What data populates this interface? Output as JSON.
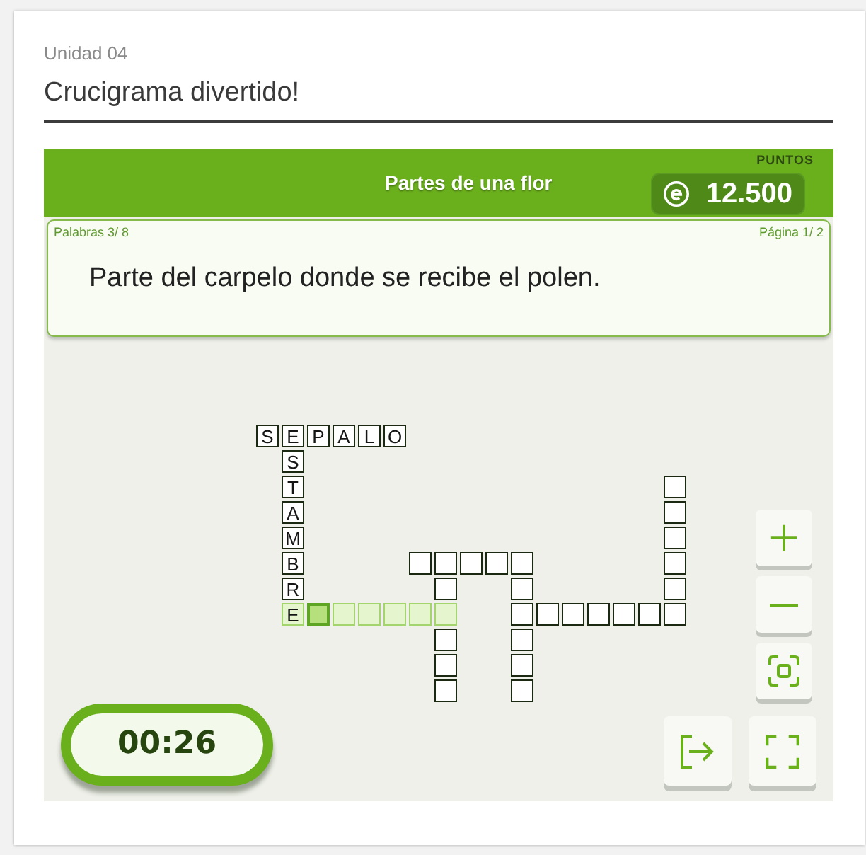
{
  "unit": "Unidad 04",
  "title": "Crucigrama divertido!",
  "game": {
    "topic": "Partes de una flor",
    "points": {
      "label": "PUNTOS",
      "value": "12.500"
    },
    "clue": {
      "words": "Palabras 3/ 8",
      "page": "Página 1/ 2",
      "text": "Parte del carpelo donde se recibe el polen."
    },
    "grid": {
      "rows": [
        {
          "cells": [
            {
              "kind": "square",
              "letter": "S",
              "highlighted": false,
              "selected": false
            },
            {
              "kind": "square",
              "letter": "E",
              "highlighted": false,
              "selected": false
            },
            {
              "kind": "square",
              "letter": "P",
              "highlighted": false,
              "selected": false
            },
            {
              "kind": "square",
              "letter": "A",
              "highlighted": false,
              "selected": false
            },
            {
              "kind": "square",
              "letter": "L",
              "highlighted": false,
              "selected": false
            },
            {
              "kind": "square",
              "letter": "O",
              "highlighted": false,
              "selected": false
            },
            {
              "kind": "gap"
            },
            {
              "kind": "gap"
            },
            {
              "kind": "gap"
            },
            {
              "kind": "gap"
            },
            {
              "kind": "gap"
            },
            {
              "kind": "gap"
            },
            {
              "kind": "gap"
            },
            {
              "kind": "gap"
            },
            {
              "kind": "gap"
            },
            {
              "kind": "gap"
            },
            {
              "kind": "gap"
            }
          ]
        },
        {
          "cells": [
            {
              "kind": "gap"
            },
            {
              "kind": "square",
              "letter": "S",
              "highlighted": false,
              "selected": false
            },
            {
              "kind": "gap"
            },
            {
              "kind": "gap"
            },
            {
              "kind": "gap"
            },
            {
              "kind": "gap"
            },
            {
              "kind": "gap"
            },
            {
              "kind": "gap"
            },
            {
              "kind": "gap"
            },
            {
              "kind": "gap"
            },
            {
              "kind": "gap"
            },
            {
              "kind": "gap"
            },
            {
              "kind": "gap"
            },
            {
              "kind": "gap"
            },
            {
              "kind": "gap"
            },
            {
              "kind": "gap"
            },
            {
              "kind": "gap"
            }
          ]
        },
        {
          "cells": [
            {
              "kind": "gap"
            },
            {
              "kind": "square",
              "letter": "T",
              "highlighted": false,
              "selected": false
            },
            {
              "kind": "gap"
            },
            {
              "kind": "gap"
            },
            {
              "kind": "gap"
            },
            {
              "kind": "gap"
            },
            {
              "kind": "gap"
            },
            {
              "kind": "gap"
            },
            {
              "kind": "gap"
            },
            {
              "kind": "gap"
            },
            {
              "kind": "gap"
            },
            {
              "kind": "gap"
            },
            {
              "kind": "gap"
            },
            {
              "kind": "gap"
            },
            {
              "kind": "gap"
            },
            {
              "kind": "gap"
            },
            {
              "kind": "square",
              "highlighted": false,
              "selected": false
            }
          ]
        },
        {
          "cells": [
            {
              "kind": "gap"
            },
            {
              "kind": "square",
              "letter": "A",
              "highlighted": false,
              "selected": false
            },
            {
              "kind": "gap"
            },
            {
              "kind": "gap"
            },
            {
              "kind": "gap"
            },
            {
              "kind": "gap"
            },
            {
              "kind": "gap"
            },
            {
              "kind": "gap"
            },
            {
              "kind": "gap"
            },
            {
              "kind": "gap"
            },
            {
              "kind": "gap"
            },
            {
              "kind": "gap"
            },
            {
              "kind": "gap"
            },
            {
              "kind": "gap"
            },
            {
              "kind": "gap"
            },
            {
              "kind": "gap"
            },
            {
              "kind": "square",
              "highlighted": false,
              "selected": false
            }
          ]
        },
        {
          "cells": [
            {
              "kind": "gap"
            },
            {
              "kind": "square",
              "letter": "M",
              "highlighted": false,
              "selected": false
            },
            {
              "kind": "gap"
            },
            {
              "kind": "gap"
            },
            {
              "kind": "gap"
            },
            {
              "kind": "gap"
            },
            {
              "kind": "gap"
            },
            {
              "kind": "gap"
            },
            {
              "kind": "gap"
            },
            {
              "kind": "gap"
            },
            {
              "kind": "gap"
            },
            {
              "kind": "gap"
            },
            {
              "kind": "gap"
            },
            {
              "kind": "gap"
            },
            {
              "kind": "gap"
            },
            {
              "kind": "gap"
            },
            {
              "kind": "square",
              "highlighted": false,
              "selected": false
            }
          ]
        },
        {
          "cells": [
            {
              "kind": "gap"
            },
            {
              "kind": "square",
              "letter": "B",
              "highlighted": false,
              "selected": false
            },
            {
              "kind": "gap"
            },
            {
              "kind": "gap"
            },
            {
              "kind": "gap"
            },
            {
              "kind": "gap"
            },
            {
              "kind": "square",
              "highlighted": false,
              "selected": false
            },
            {
              "kind": "square",
              "highlighted": false,
              "selected": false
            },
            {
              "kind": "square",
              "highlighted": false,
              "selected": false
            },
            {
              "kind": "square",
              "highlighted": false,
              "selected": false
            },
            {
              "kind": "square",
              "highlighted": false,
              "selected": false
            },
            {
              "kind": "gap"
            },
            {
              "kind": "gap"
            },
            {
              "kind": "gap"
            },
            {
              "kind": "gap"
            },
            {
              "kind": "gap"
            },
            {
              "kind": "square",
              "highlighted": false,
              "selected": false
            }
          ]
        },
        {
          "cells": [
            {
              "kind": "gap"
            },
            {
              "kind": "square",
              "letter": "R",
              "highlighted": false,
              "selected": false
            },
            {
              "kind": "gap"
            },
            {
              "kind": "gap"
            },
            {
              "kind": "gap"
            },
            {
              "kind": "gap"
            },
            {
              "kind": "gap"
            },
            {
              "kind": "square",
              "highlighted": false,
              "selected": false
            },
            {
              "kind": "gap"
            },
            {
              "kind": "gap"
            },
            {
              "kind": "square",
              "highlighted": false,
              "selected": false
            },
            {
              "kind": "gap"
            },
            {
              "kind": "gap"
            },
            {
              "kind": "gap"
            },
            {
              "kind": "gap"
            },
            {
              "kind": "gap"
            },
            {
              "kind": "square",
              "highlighted": false,
              "selected": false
            }
          ]
        },
        {
          "cells": [
            {
              "kind": "gap"
            },
            {
              "kind": "square",
              "letter": "E",
              "highlighted": true,
              "selected": false
            },
            {
              "kind": "square",
              "highlighted": true,
              "selected": true
            },
            {
              "kind": "square",
              "highlighted": true,
              "selected": false
            },
            {
              "kind": "square",
              "highlighted": true,
              "selected": false
            },
            {
              "kind": "square",
              "highlighted": true,
              "selected": false
            },
            {
              "kind": "square",
              "highlighted": true,
              "selected": false
            },
            {
              "kind": "square",
              "highlighted": true,
              "selected": false
            },
            {
              "kind": "gap"
            },
            {
              "kind": "gap"
            },
            {
              "kind": "square",
              "highlighted": false,
              "selected": false
            },
            {
              "kind": "square",
              "highlighted": false,
              "selected": false
            },
            {
              "kind": "square",
              "highlighted": false,
              "selected": false
            },
            {
              "kind": "square",
              "highlighted": false,
              "selected": false
            },
            {
              "kind": "square",
              "highlighted": false,
              "selected": false
            },
            {
              "kind": "square",
              "highlighted": false,
              "selected": false
            },
            {
              "kind": "square",
              "highlighted": false,
              "selected": false
            }
          ]
        },
        {
          "cells": [
            {
              "kind": "gap"
            },
            {
              "kind": "gap"
            },
            {
              "kind": "gap"
            },
            {
              "kind": "gap"
            },
            {
              "kind": "gap"
            },
            {
              "kind": "gap"
            },
            {
              "kind": "gap"
            },
            {
              "kind": "square",
              "highlighted": false,
              "selected": false
            },
            {
              "kind": "gap"
            },
            {
              "kind": "gap"
            },
            {
              "kind": "square",
              "highlighted": false,
              "selected": false
            },
            {
              "kind": "gap"
            },
            {
              "kind": "gap"
            },
            {
              "kind": "gap"
            },
            {
              "kind": "gap"
            },
            {
              "kind": "gap"
            },
            {
              "kind": "gap"
            }
          ]
        },
        {
          "cells": [
            {
              "kind": "gap"
            },
            {
              "kind": "gap"
            },
            {
              "kind": "gap"
            },
            {
              "kind": "gap"
            },
            {
              "kind": "gap"
            },
            {
              "kind": "gap"
            },
            {
              "kind": "gap"
            },
            {
              "kind": "square",
              "highlighted": false,
              "selected": false
            },
            {
              "kind": "gap"
            },
            {
              "kind": "gap"
            },
            {
              "kind": "square",
              "highlighted": false,
              "selected": false
            },
            {
              "kind": "gap"
            },
            {
              "kind": "gap"
            },
            {
              "kind": "gap"
            },
            {
              "kind": "gap"
            },
            {
              "kind": "gap"
            },
            {
              "kind": "gap"
            }
          ]
        },
        {
          "cells": [
            {
              "kind": "gap"
            },
            {
              "kind": "gap"
            },
            {
              "kind": "gap"
            },
            {
              "kind": "gap"
            },
            {
              "kind": "gap"
            },
            {
              "kind": "gap"
            },
            {
              "kind": "gap"
            },
            {
              "kind": "square",
              "highlighted": false,
              "selected": false
            },
            {
              "kind": "gap"
            },
            {
              "kind": "gap"
            },
            {
              "kind": "square",
              "highlighted": false,
              "selected": false
            },
            {
              "kind": "gap"
            },
            {
              "kind": "gap"
            },
            {
              "kind": "gap"
            },
            {
              "kind": "gap"
            },
            {
              "kind": "gap"
            },
            {
              "kind": "gap"
            }
          ]
        }
      ]
    },
    "timer": "00:26"
  }
}
